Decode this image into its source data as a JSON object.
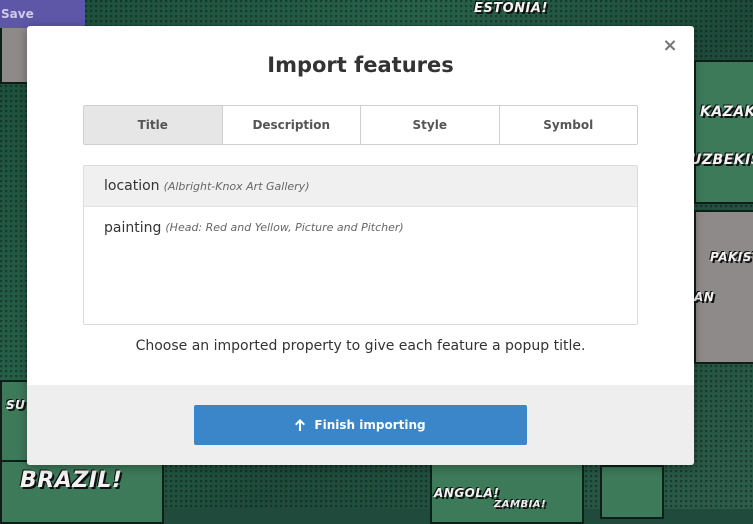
{
  "background_map": {
    "save_label": "Save",
    "labels": [
      "ESTONIA!",
      "KAZAKHS",
      "UZBEKIST",
      "PAKIST",
      "AN",
      "SU",
      "BRAZIL!",
      "ANGOLA!",
      "ZAMBIA!"
    ]
  },
  "modal": {
    "title": "Import features",
    "close_glyph": "×",
    "tabs": [
      {
        "label": "Title",
        "active": true
      },
      {
        "label": "Description",
        "active": false
      },
      {
        "label": "Style",
        "active": false
      },
      {
        "label": "Symbol",
        "active": false
      }
    ],
    "properties": [
      {
        "key": "location",
        "example": "(Albright-Knox Art Gallery)",
        "selected": true
      },
      {
        "key": "painting",
        "example": "(Head: Red and Yellow, Picture and Pitcher)",
        "selected": false
      }
    ],
    "hint": "Choose an imported property to give each feature a popup title.",
    "finish_label": "Finish importing",
    "finish_icon": "arrow-up-icon"
  },
  "colors": {
    "primary_button": "#3a86c8",
    "active_tab": "#e6e6e6",
    "footer": "#eeeeee"
  }
}
